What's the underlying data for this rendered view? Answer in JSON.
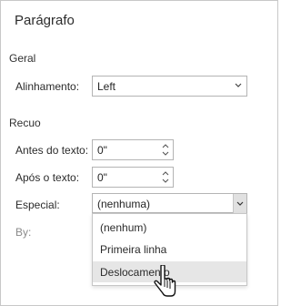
{
  "dialog": {
    "title": "Parágrafo"
  },
  "geral": {
    "heading": "Geral",
    "alinhamento": {
      "label": "Alinhamento:",
      "value": "Left"
    }
  },
  "recuo": {
    "heading": "Recuo",
    "antes": {
      "label": "Antes do texto:",
      "value": "0\""
    },
    "apos": {
      "label": "Após o texto:",
      "value": "0\""
    },
    "especial": {
      "label": "Especial:",
      "value": "(nenhuma)",
      "options": [
        "(nenhum)",
        "Primeira linha",
        "Deslocamento"
      ],
      "highlighted_option": "Deslocamento"
    },
    "by": {
      "label": "By:"
    }
  },
  "icons": {
    "chevron": "chevron-down-icon",
    "spinner": "spinner-arrows-icon",
    "cursor": "mouse-pointer-icon"
  }
}
